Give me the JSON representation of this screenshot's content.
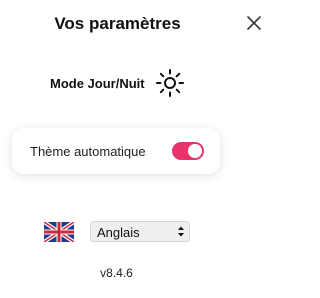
{
  "header": {
    "title": "Vos paramètres",
    "close_icon": "close-icon"
  },
  "mode": {
    "label": "Mode Jour/Nuit",
    "icon": "sun-icon"
  },
  "auto_theme": {
    "label": "Thème automatique",
    "enabled": true
  },
  "language": {
    "flag_icon": "uk-flag-icon",
    "selected": "Anglais"
  },
  "footer": {
    "version": "v8.4.6"
  },
  "colors": {
    "toggle_on": "#e8336d",
    "text": "#111111"
  }
}
